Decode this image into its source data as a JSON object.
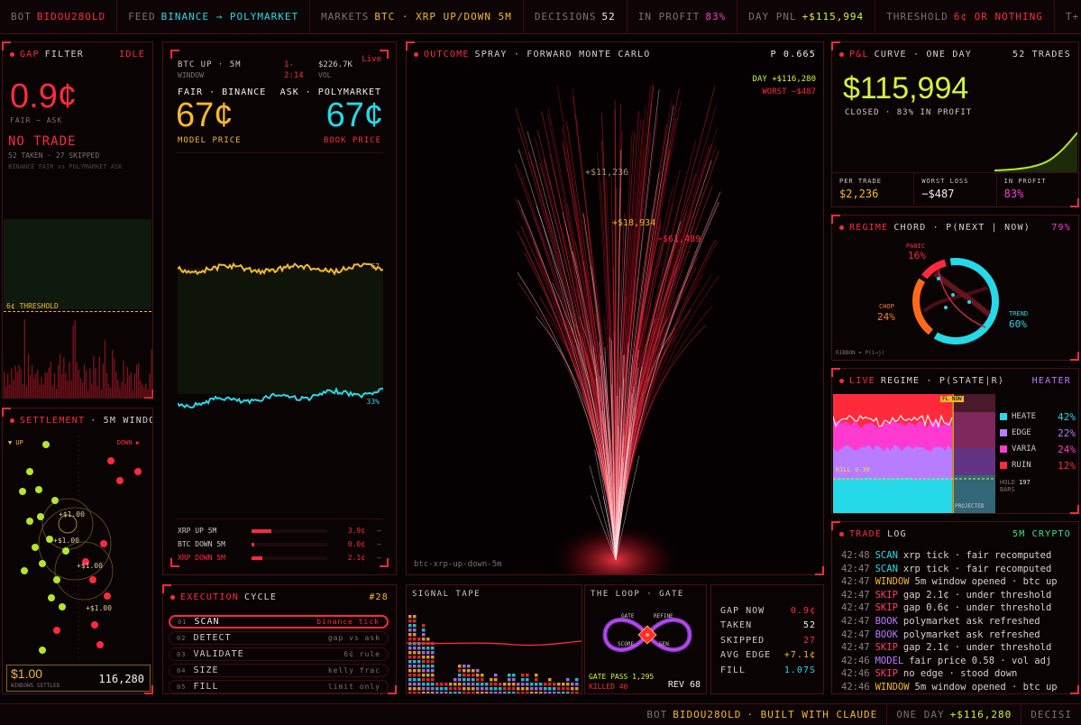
{
  "topbar": {
    "bot_label": "BOT",
    "bot_value": "BIDOU28OLD",
    "feed_label": "FEED",
    "feed_value": "BINANCE → POLYMARKET",
    "markets_label": "MARKETS",
    "markets_value": "BTC · XRP UP/DOWN 5M",
    "decisions_label": "DECISIONS",
    "decisions_value": "52",
    "inprofit_label": "IN PROFIT",
    "inprofit_value": "83%",
    "daypnl_label": "DAY PNL",
    "daypnl_value": "+$115,994",
    "threshold_label": "THRESHOLD",
    "threshold_value": "6¢ OR NOTHING",
    "clock": "T+ 00:0"
  },
  "gap_filter": {
    "title_a": "GAP",
    "title_b": "FILTER",
    "status": "IDLE",
    "gap_value": "0.9¢",
    "gap_caption": "FAIR − ASK",
    "verdict": "NO TRADE",
    "counts": "52 TAKEN · 27 SKIPPED",
    "subcaption": "BINANCE FAIR vs POLYMARKET ASK",
    "threshold_label": "6¢ THRESHOLD"
  },
  "fair_panel": {
    "market": "BTC UP · 5M",
    "window_label": "WINDOW",
    "window_value": "1-",
    "time": "2:14",
    "volume": "$226.7K",
    "vol_label": "VOL",
    "live": "Live",
    "fair_label": "FAIR · BINANCE",
    "ask_label": "ASK · POLYMARKET",
    "model_price": "67¢",
    "model_caption": "MODEL PRICE",
    "book_price": "67¢",
    "book_caption": "BOOK PRICE",
    "top_tag": "67",
    "bottom_tag": "33%",
    "rows": [
      {
        "label": "XRP UP 5M",
        "value": "3.9¢",
        "fill": 0.26,
        "color": "#ff2a3c",
        "dash": "–"
      },
      {
        "label": "BTC DOWN 5M",
        "value": "0.0¢",
        "fill": 0.03,
        "color": "#ff2a3c",
        "dash": "–"
      },
      {
        "label": "XRP DOWN 5M",
        "value": "2.1¢",
        "fill": 0.14,
        "color": "#ff2a3c",
        "dash": "–"
      }
    ]
  },
  "spray": {
    "title_a": "OUTCOME",
    "title_b": "SPRAY · FORWARD MONTE CARLO",
    "p_value": "P 0.665",
    "day": "DAY +$116,280",
    "worst": "WORST −$487",
    "label_1": "+$11,236",
    "label_2": "+$18,934",
    "label_3": "−$61,489",
    "footer": "btc-xrp-up-down-5m"
  },
  "pnl": {
    "title_a": "P&L",
    "title_b": "CURVE · ONE DAY",
    "trades": "52 TRADES",
    "total": "$115,994",
    "caption": "CLOSED · 83% IN PROFIT",
    "stats": [
      {
        "label": "PER TRADE",
        "value": "$2,236",
        "color": "#f5b82a"
      },
      {
        "label": "WORST LOSS",
        "value": "−$487",
        "color": "#f2eeee"
      },
      {
        "label": "IN PROFIT",
        "value": "83%",
        "color": "#ff3ad0"
      }
    ]
  },
  "regime_chord": {
    "title_a": "REGIME",
    "title_b": "CHORD · P(NEXT | NOW)",
    "pct": "79%",
    "panic_label": "PANIC",
    "panic_value": "16%",
    "chop_label": "CHOP",
    "chop_value": "24%",
    "trend_label": "TREND",
    "trend_value": "60%",
    "footer": "RIBBON = P(i→j)"
  },
  "live_regime": {
    "title_a": "LIVE",
    "title_b": "REGIME · P(STATE|R)",
    "state": "HEATER",
    "now_tag": "FL NOW",
    "kill": "KILL 0.30",
    "projected": "PROJECTED",
    "legend": [
      {
        "name": "HEATE",
        "value": "42%",
        "color": "#25d9e8"
      },
      {
        "name": "EDGE",
        "value": "22%",
        "color": "#b77cff"
      },
      {
        "name": "VARIA",
        "value": "24%",
        "color": "#ff3ad0"
      },
      {
        "name": "RUIN",
        "value": "12%",
        "color": "#ff2a3c"
      }
    ],
    "hold_label": "HOLD",
    "hold_value": "197",
    "bars_label": "BARS"
  },
  "settlement": {
    "title_a": "SETTLEMENT",
    "title_b": "· 5M WINDO",
    "up_label": "▼ UP",
    "down_label": "DOWN ▶",
    "amt_1": "+$1.00",
    "amt_2": "+$1.00",
    "amt_3": "+$1.00",
    "amt_4": "+$1.00",
    "total": "$1.00",
    "total_caption": "WINDOWS SETTLED",
    "windows": "116,280"
  },
  "execution": {
    "title_a": "EXECUTION",
    "title_b": "CYCLE",
    "cycle": "#28",
    "steps": [
      {
        "num": "01",
        "label": "SCAN",
        "hint": "binance tick"
      },
      {
        "num": "02",
        "label": "DETECT",
        "hint": "gap vs ask"
      },
      {
        "num": "03",
        "label": "VALIDATE",
        "hint": "6¢ rule"
      },
      {
        "num": "04",
        "label": "SIZE",
        "hint": "kelly frac"
      },
      {
        "num": "05",
        "label": "FILL",
        "hint": "limit only"
      }
    ]
  },
  "signal_tape": {
    "title": "SIGNAL TAPE"
  },
  "loop": {
    "title": "THE LOOP · GATE",
    "gate": "GATE",
    "refine": "REFINE",
    "score": "SCORE",
    "gen": "GEN",
    "gate_pass": "GATE PASS 1,295",
    "killed": "KILLED 40",
    "rev": "REV 68"
  },
  "gap_stats": [
    {
      "label": "GAP NOW",
      "value": "0.9¢",
      "color": "#ff2a3c"
    },
    {
      "label": "TAKEN",
      "value": "52",
      "color": "#f2eeee"
    },
    {
      "label": "SKIPPED",
      "value": "27",
      "color": "#ff2a3c"
    },
    {
      "label": "AVG EDGE",
      "value": "+7.1¢",
      "color": "#f5b82a"
    },
    {
      "label": "FILL",
      "value": "1.07S",
      "color": "#25d9e8"
    }
  ],
  "trade_log": {
    "title_a": "TRADE",
    "title_b": "LOG",
    "subtitle": "5M CRYPTO",
    "lines": [
      {
        "time": "42:48",
        "tag": "SCAN",
        "color": "#25d9e8",
        "text": "xrp tick · fair recomputed"
      },
      {
        "time": "42:47",
        "tag": "SCAN",
        "color": "#25d9e8",
        "text": "xrp tick · fair recomputed"
      },
      {
        "time": "42:47",
        "tag": "WINDOW",
        "color": "#f5b82a",
        "text": "5m window opened · btc up"
      },
      {
        "time": "42:47",
        "tag": "SKIP",
        "color": "#ff3a6a",
        "text": "gap 2.1¢ · under threshold"
      },
      {
        "time": "42:47",
        "tag": "SKIP",
        "color": "#ff3a6a",
        "text": "gap 0.6¢ · under threshold"
      },
      {
        "time": "42:47",
        "tag": "BOOK",
        "color": "#b77cff",
        "text": "polymarket ask refreshed"
      },
      {
        "time": "42:47",
        "tag": "BOOK",
        "color": "#b77cff",
        "text": "polymarket ask refreshed"
      },
      {
        "time": "42:47",
        "tag": "SKIP",
        "color": "#ff3a6a",
        "text": "gap 2.1¢ · under threshold"
      },
      {
        "time": "42:46",
        "tag": "MODEL",
        "color": "#b77cff",
        "text": "fair price 0.58 · vol adj"
      },
      {
        "time": "42:46",
        "tag": "SKIP",
        "color": "#ff3a6a",
        "text": "no edge · stood down"
      },
      {
        "time": "42:46",
        "tag": "WINDOW",
        "color": "#f5b82a",
        "text": "5m window opened · btc up"
      }
    ]
  },
  "bottombar": {
    "bot_label": "BOT",
    "bot_value": "BIDOU28OLD",
    "built": "· BUILT WITH CLAUDE",
    "day_label": "ONE DAY",
    "day_value": "+$116,280",
    "tail": "DECISI"
  }
}
